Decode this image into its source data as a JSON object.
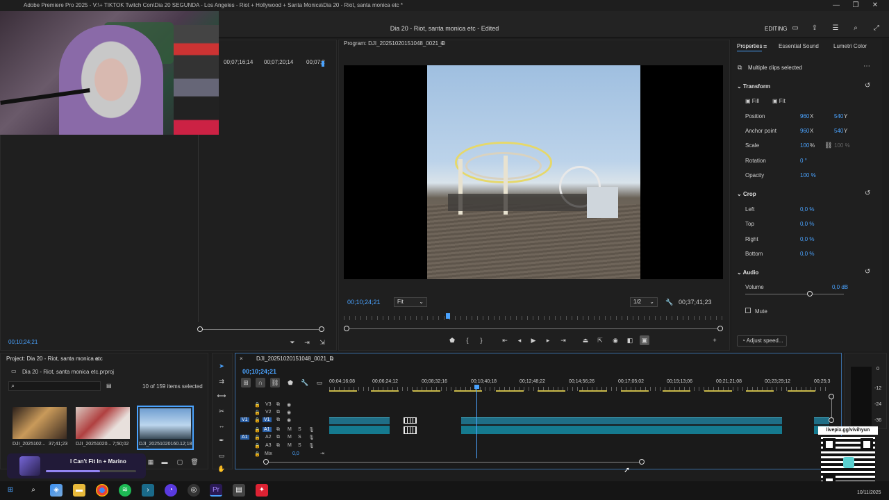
{
  "window": {
    "title": "Adobe Premiere Pro 2025 - V:\\+ TIKTOK Twitch Con\\Dia 20 SEGUNDA - Los Angeles - Riot + Hollywood + Santa Monica\\Dia 20 - Riot, santa monica etc *",
    "controls": [
      "—",
      "❐",
      "✕"
    ]
  },
  "header": {
    "doc_title": "Dia 20 - Riot, santa monica etc",
    "edited": "Edited",
    "workspace": "EDITING"
  },
  "source": {
    "timecodes": [
      "00;07;16;14",
      "00;07;20;14",
      "00;07;2"
    ],
    "current_tc": "00;10;24;21"
  },
  "program": {
    "label": "Program: DJI_20251020151048_0021_D",
    "current_tc": "00;10;24;21",
    "fit": "Fit",
    "resolution": "1/2",
    "duration": "00;37;41;23"
  },
  "properties": {
    "tabs": [
      "Properties",
      "Essential Sound",
      "Lumetri Color"
    ],
    "selection": "Multiple clips selected",
    "transform": {
      "title": "Transform",
      "fill": "Fill",
      "fit": "Fit",
      "position_label": "Position",
      "position_x": "960",
      "position_y": "540",
      "anchor_label": "Anchor point",
      "anchor_x": "960",
      "anchor_y": "540",
      "x_unit": "X",
      "y_unit": "Y",
      "scale_label": "Scale",
      "scale": "100",
      "scale_unit": "%",
      "scale_linked": "100 %",
      "rotation_label": "Rotation",
      "rotation": "0 °",
      "opacity_label": "Opacity",
      "opacity": "100 %"
    },
    "crop": {
      "title": "Crop",
      "left_label": "Left",
      "left": "0,0 %",
      "top_label": "Top",
      "top": "0,0 %",
      "right_label": "Right",
      "right": "0,0 %",
      "bottom_label": "Bottom",
      "bottom": "0,0 %"
    },
    "audio": {
      "title": "Audio",
      "volume_label": "Volume",
      "volume": "0,0 dB",
      "mute_label": "Mute"
    },
    "adjust_speed": "Adjust speed..."
  },
  "project": {
    "title": "Project: Dia 20 - Riot, santa monica etc",
    "file": "Dia 20 - Riot, santa monica etc.prproj",
    "items_count": "10 of 159 items selected",
    "thumbs": [
      {
        "name": "DJI_2025102...",
        "duration": "37;41;23"
      },
      {
        "name": "DJI_20251020...",
        "duration": "7;50;02"
      },
      {
        "name": "DJI_20251020160...",
        "duration": "12;18"
      }
    ],
    "now_playing": "I Can't Fit In + Marino"
  },
  "timeline": {
    "sequence": "DJI_20251020151048_0021_D",
    "current_tc": "00;10;24;21",
    "ruler": [
      "00;04;16;08",
      "00;06;24;12",
      "00;08;32;16",
      "00;10;40;18",
      "00;12;48;22",
      "00;14;56;26",
      "00;17;05;02",
      "00;19;13;06",
      "00;21;21;08",
      "00;23;29;12",
      "00;25;3"
    ],
    "tracks_video": [
      "V3",
      "V2",
      "V1"
    ],
    "tracks_audio": [
      "A1",
      "A2",
      "A3"
    ],
    "mix_label": "Mix",
    "mix_value": "0,0",
    "track_m": "M",
    "track_s": "S",
    "source_v1": "V1",
    "source_a1": "A1"
  },
  "meters": [
    "0",
    "-12",
    "-24",
    "-36"
  ],
  "overlay": {
    "qr_caption": "livepix.gg/vivihyun"
  },
  "taskbar": {
    "date": "10/11/2025"
  }
}
